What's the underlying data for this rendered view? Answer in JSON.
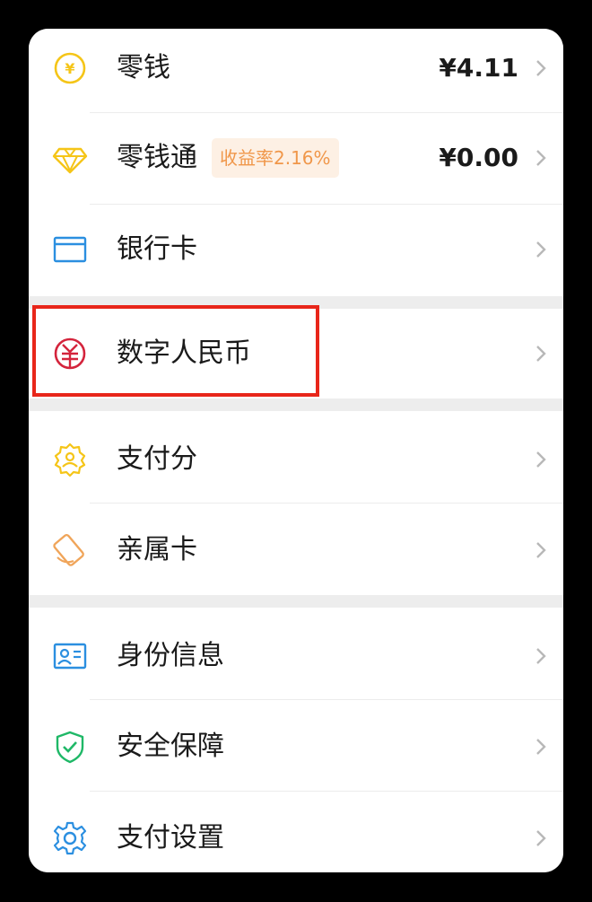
{
  "wallet": {
    "items": [
      {
        "label": "零钱",
        "value": "¥4.11",
        "icon": "yuan-coin-icon"
      },
      {
        "label": "零钱通",
        "badge": "收益率2.16%",
        "value": "¥0.00",
        "icon": "diamond-icon"
      },
      {
        "label": "银行卡",
        "icon": "bank-card-icon"
      },
      {
        "label": "数字人民币",
        "icon": "digital-rmb-icon"
      },
      {
        "label": "支付分",
        "icon": "pay-score-icon"
      },
      {
        "label": "亲属卡",
        "icon": "family-card-icon"
      },
      {
        "label": "身份信息",
        "icon": "id-card-icon"
      },
      {
        "label": "安全保障",
        "icon": "shield-check-icon"
      },
      {
        "label": "支付设置",
        "icon": "gear-icon"
      }
    ]
  },
  "colors": {
    "yellow_icon": "#f5c518",
    "blue_icon": "#2b8fe0",
    "red_icon": "#d4243c",
    "orange_icon": "#f0a55a",
    "green_icon": "#1fb867",
    "highlight": "#e8261a",
    "badge_bg": "#fdf0e4",
    "badge_text": "#f0974a"
  }
}
